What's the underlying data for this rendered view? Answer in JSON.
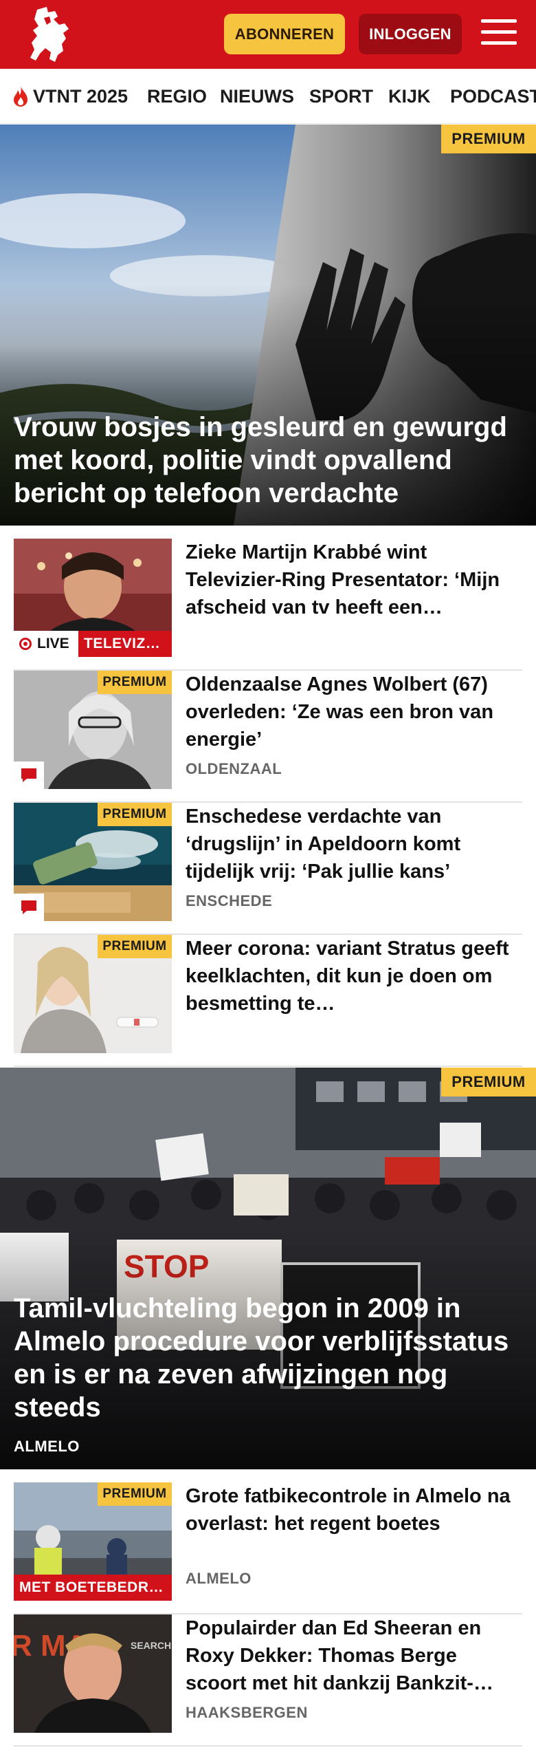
{
  "header": {
    "subscribe_label": "ABONNEREN",
    "login_label": "INLOGGEN",
    "brand_color": "#d2121a",
    "accent_color": "#f7c440"
  },
  "nav": {
    "items": [
      "VTNT 2025",
      "REGIO",
      "NIEUWS",
      "SPORT",
      "KIJK",
      "PODCAST"
    ]
  },
  "hero1": {
    "title": "Vrouw bosjes in gesleurd en gewurgd met koord, politie vindt opvallend bericht op telefoon verdachte",
    "badge": "PREMIUM"
  },
  "articles": [
    {
      "title": "Zieke Martijn Krabbé wint Televizier-Ring Presentator: ‘Mijn afscheid van tv heeft een…",
      "live": "LIVE",
      "tag": "TELEVIZ…"
    },
    {
      "title": "Oldenzaalse Agnes Wolbert (67) overleden: ‘Ze was een bron van energie’",
      "location": "OLDENZAAL",
      "badge": "PREMIUM"
    },
    {
      "title": "Enschedese verdachte van ‘drugslijn’ in Apeldoorn komt tijdelijk vrij: ‘Pak jullie kans’",
      "location": "ENSCHEDE",
      "badge": "PREMIUM"
    },
    {
      "title": "Meer corona: variant Stratus geeft keelklachten, dit kun je doen om besmetting te…",
      "badge": "PREMIUM"
    }
  ],
  "hero2": {
    "title": "Tamil-vluchteling begon in 2009 in Almelo procedure voor verblijfsstatus en is er na zeven afwijzingen nog steeds",
    "location": "ALMELO",
    "badge": "PREMIUM"
  },
  "articles2": [
    {
      "title": "Grote fatbikecontrole in Almelo na overlast: het regent boetes",
      "location": "ALMELO",
      "badge": "PREMIUM",
      "tag": "MET BOETEBEDR…"
    },
    {
      "title": "Populairder dan Ed Sheeran en Roxy Dekker: Thomas Berge scoort met hit dankzij Bankzit-…",
      "location": "HAAKSBERGEN"
    }
  ]
}
